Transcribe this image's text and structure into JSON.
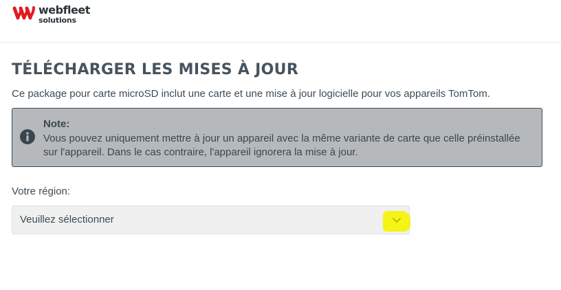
{
  "header": {
    "logo": {
      "word1": "webfleet",
      "word2": "solutions",
      "icon": "webfleet-logo-icon"
    }
  },
  "page": {
    "title": "TÉLÉCHARGER LES MISES À JOUR",
    "description": "Ce package pour carte microSD inclut une carte et une mise à jour logicielle pour vos appareils TomTom."
  },
  "note": {
    "icon": "info-icon",
    "title": "Note:",
    "text": "Vous pouvez uniquement mettre à jour un appareil avec la même variante de carte que celle préinstallée sur l'appareil. Dans le cas contraire, l'appareil ignorera la mise à jour."
  },
  "region": {
    "label": "Votre région:",
    "selected": "Veuillez sélectionner",
    "icon": "chevron-down-icon",
    "highlight_color": "#f6f20a"
  },
  "colors": {
    "note_background": "#b6b9bb",
    "text": "#3d4a54",
    "logo_red": "#e11b22"
  }
}
